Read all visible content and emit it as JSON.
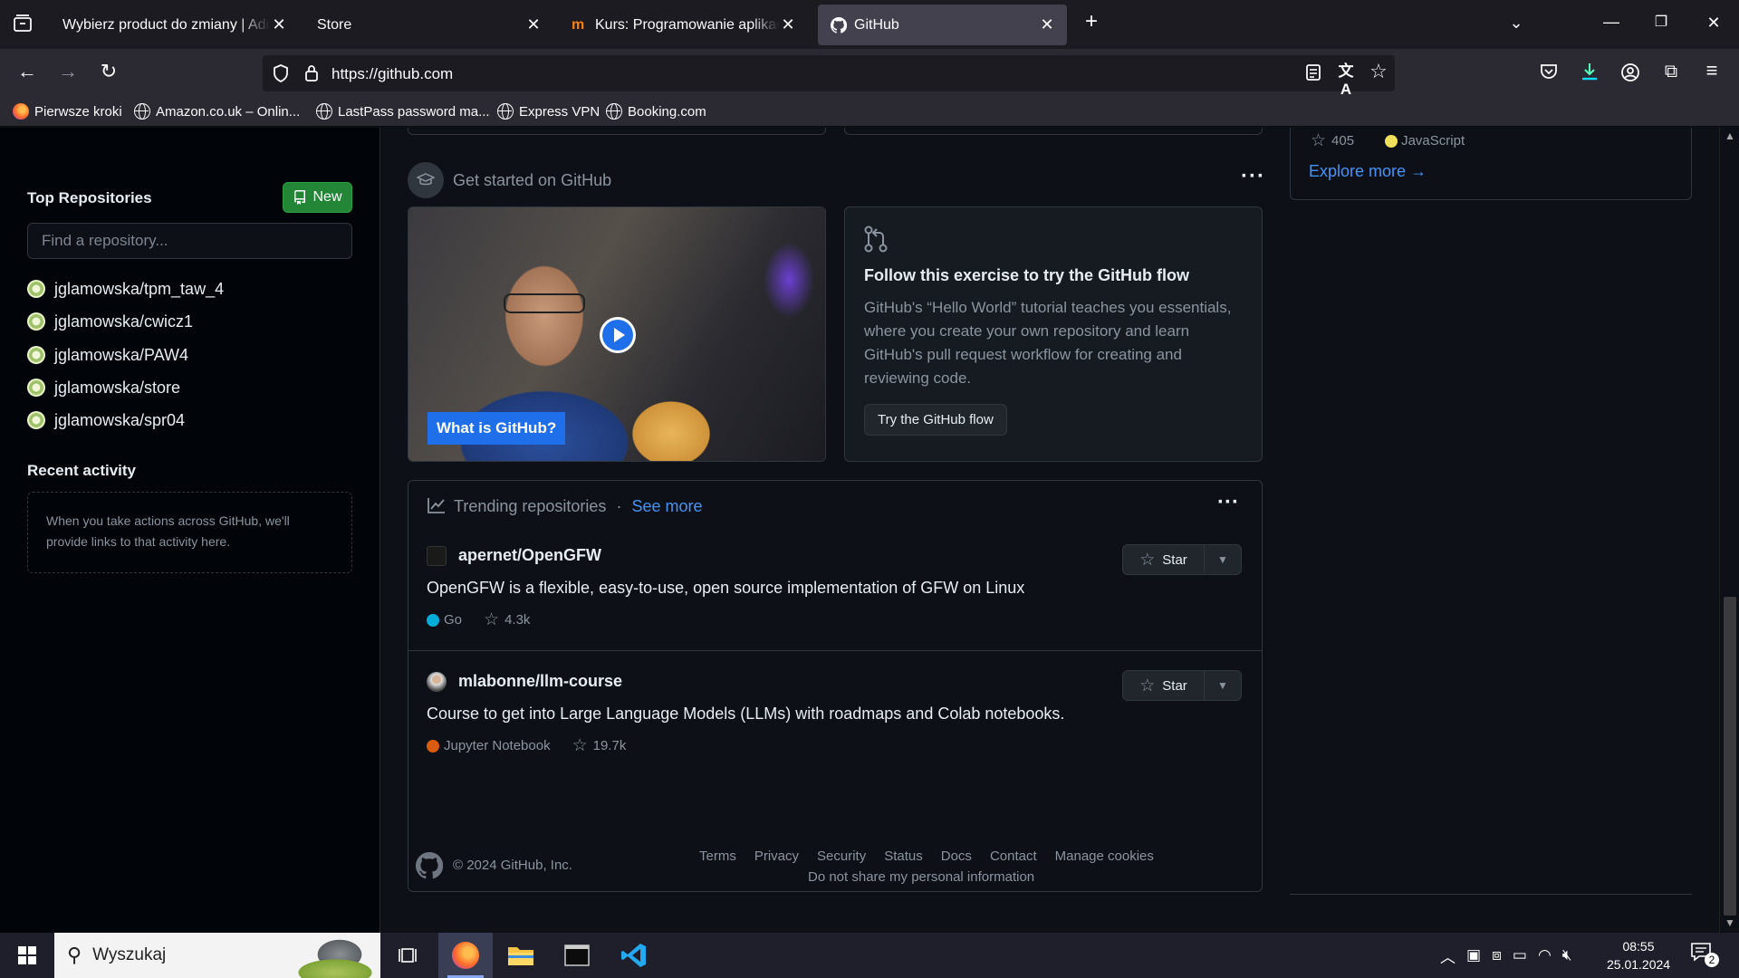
{
  "browser": {
    "tabs": [
      {
        "title": "Wybierz product do zmiany | Administracja",
        "active": false
      },
      {
        "title": "Store",
        "active": false
      },
      {
        "title": "Kurs: Programowanie aplikacji webowych",
        "active": false
      },
      {
        "title": "GitHub",
        "active": true
      }
    ],
    "url": "https://github.com",
    "bookmarks": [
      "Pierwsze kroki",
      "Amazon.co.uk – Onlin...",
      "LastPass password ma...",
      "Express VPN",
      "Booking.com"
    ]
  },
  "sidebar": {
    "top_repositories_title": "Top Repositories",
    "new_button": "New",
    "find_placeholder": "Find a repository...",
    "repos": [
      "jglamowska/tpm_taw_4",
      "jglamowska/cwicz1",
      "jglamowska/PAW4",
      "jglamowska/store",
      "jglamowska/spr04"
    ],
    "recent_activity_title": "Recent activity",
    "recent_activity_text": "When you take actions across GitHub, we'll provide links to that activity here."
  },
  "main": {
    "get_started_title": "Get started on GitHub",
    "video_label": "What is GitHub?",
    "flow_title": "Follow this exercise to try the GitHub flow",
    "flow_text": "GitHub's “Hello World” tutorial teaches you essentials, where you create your own repository and learn GitHub's pull request workflow for creating and reviewing code.",
    "flow_button": "Try the GitHub flow",
    "trending_title": "Trending repositories",
    "trending_sep": "·",
    "see_more": "See more",
    "trending": [
      {
        "name": "apernet/OpenGFW",
        "description": "OpenGFW is a flexible, easy-to-use, open source implementation of GFW on Linux",
        "language": "Go",
        "language_color": "#00add8",
        "stars": "4.3k",
        "star_label": "Star"
      },
      {
        "name": "mlabonne/llm-course",
        "description": "Course to get into Large Language Models (LLMs) with roadmaps and Colab notebooks.",
        "language": "Jupyter Notebook",
        "language_color": "#da5b0b",
        "stars": "19.7k",
        "star_label": "Star"
      }
    ]
  },
  "right": {
    "partial_stars": "405",
    "partial_language": "JavaScript",
    "partial_language_color": "#f1e05a",
    "explore_more": "Explore more →"
  },
  "footer": {
    "copyright": "© 2024 GitHub, Inc.",
    "links": [
      "Terms",
      "Privacy",
      "Security",
      "Status",
      "Docs",
      "Contact",
      "Manage cookies"
    ],
    "do_not_share": "Do not share my personal information"
  },
  "taskbar": {
    "search_placeholder": "Wyszukaj",
    "time": "08:55",
    "date": "25.01.2024",
    "notifications": "2"
  }
}
